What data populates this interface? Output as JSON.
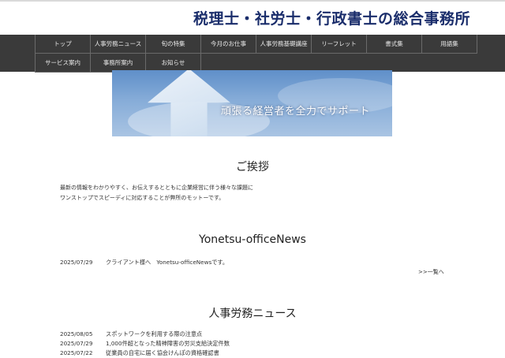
{
  "site": {
    "title": "税理士・社労士・行政書士の総合事務所"
  },
  "nav": {
    "row1": [
      "トップ",
      "人事労務ニュース",
      "旬の特集",
      "今月のお仕事",
      "人事労務基礎講座",
      "リーフレット",
      "書式集",
      "用語集"
    ],
    "row2": [
      "サービス案内",
      "事務所案内",
      "お知らせ"
    ]
  },
  "hero": {
    "caption": "頑張る経営者を全力でサポート"
  },
  "greeting": {
    "title": "ご挨拶",
    "lines": [
      "最新の情報をわかりやすく、お伝えするとともに企業経営に伴う様々な課題に",
      "ワンストップでスピーディに対応することが弊所のモットーです。"
    ]
  },
  "news": {
    "title": "Yonetsu-officeNews",
    "items": [
      {
        "date": "2025/07/29",
        "text": "クライアント様へ　Yonetsu-officeNewsです。"
      }
    ],
    "more": ">>一覧へ"
  },
  "labor": {
    "title": "人事労務ニュース",
    "items": [
      {
        "date": "2025/08/05",
        "text": "スポットワークを利用する際の注意点"
      },
      {
        "date": "2025/07/29",
        "text": "1,000件超となった精神障害の労災支給決定件数"
      },
      {
        "date": "2025/07/22",
        "text": "従業員の自宅に届く協会けんぽの資格確認書"
      }
    ]
  },
  "colors": {
    "title": "#1a2d6b",
    "nav_bg": "#3a3a3a",
    "nav_text": "#eaeaea"
  }
}
